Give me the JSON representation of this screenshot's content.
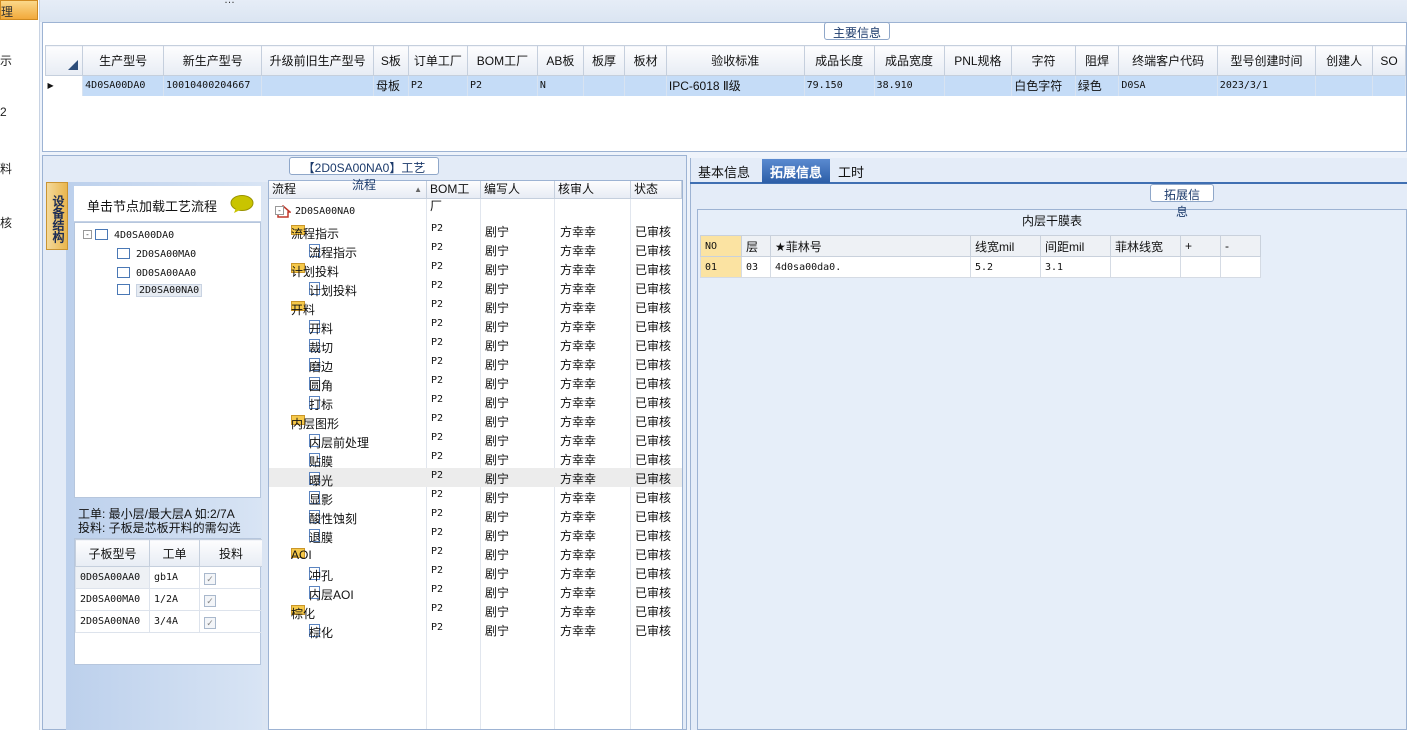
{
  "left_nav": {
    "active_label": "理",
    "items": [
      "示",
      "2",
      "料",
      "核"
    ]
  },
  "top": {
    "partial_title": "…"
  },
  "main_info": {
    "title": "主要信息",
    "columns": [
      "生产型号",
      "新生产型号",
      "升级前旧生产型号",
      "S板",
      "订单工厂",
      "BOM工厂",
      "AB板",
      "板厚",
      "板材",
      "验收标准",
      "成品长度",
      "成品宽度",
      "PNL规格",
      "字符",
      "阻焊",
      "终端客户代码",
      "型号创建时间",
      "创建人",
      "SO"
    ],
    "row": [
      "4D0SA00DA0",
      "10010400204667",
      "",
      "母板",
      "P2",
      "P2",
      "N",
      "",
      "",
      "IPC-6018 Ⅱ级",
      "79.150",
      "38.910",
      "",
      "白色字符",
      "绿色",
      "D0SA",
      "2023/3/1",
      "",
      ""
    ]
  },
  "structure_tab": "设备结构",
  "load_hint": "单击节点加载工艺流程",
  "structure_tree": {
    "root": "4D0SA00DA0",
    "children": [
      "2D0SA00MA0",
      "0D0SA00AA0",
      "2D0SA00NA0"
    ]
  },
  "hint": {
    "line1": "工单: 最小层/最大层A 如:2/7A",
    "line2": "投料: 子板是芯板开料的需勾选"
  },
  "sub_grid": {
    "headers": [
      "子板型号",
      "工单",
      "投料"
    ],
    "rows": [
      [
        "0D0SA00AA0",
        "gb1A"
      ],
      [
        "2D0SA00MA0",
        "1/2A"
      ],
      [
        "2D0SA00NA0",
        "3/4A"
      ]
    ]
  },
  "process": {
    "title": "【2D0SA00NA0】工艺流程",
    "headers": [
      "流程",
      "BOM工厂",
      "编写人",
      "核审人",
      "状态"
    ],
    "root": "2D0SA00NA0",
    "rows": [
      {
        "name": "流程指示",
        "lvl": 1,
        "bom": "P2",
        "writer": "剧宁",
        "reviewer": "方幸幸",
        "status": "已审核"
      },
      {
        "name": "流程指示",
        "lvl": 2,
        "bom": "P2",
        "writer": "剧宁",
        "reviewer": "方幸幸",
        "status": "已审核"
      },
      {
        "name": "计划投料",
        "lvl": 1,
        "bom": "P2",
        "writer": "剧宁",
        "reviewer": "方幸幸",
        "status": "已审核"
      },
      {
        "name": "计划投料",
        "lvl": 2,
        "bom": "P2",
        "writer": "剧宁",
        "reviewer": "方幸幸",
        "status": "已审核"
      },
      {
        "name": "开料",
        "lvl": 1,
        "bom": "P2",
        "writer": "剧宁",
        "reviewer": "方幸幸",
        "status": "已审核"
      },
      {
        "name": "开料",
        "lvl": 2,
        "bom": "P2",
        "writer": "剧宁",
        "reviewer": "方幸幸",
        "status": "已审核"
      },
      {
        "name": "裁切",
        "lvl": 2,
        "bom": "P2",
        "writer": "剧宁",
        "reviewer": "方幸幸",
        "status": "已审核"
      },
      {
        "name": "磨边",
        "lvl": 2,
        "bom": "P2",
        "writer": "剧宁",
        "reviewer": "方幸幸",
        "status": "已审核"
      },
      {
        "name": "圆角",
        "lvl": 2,
        "bom": "P2",
        "writer": "剧宁",
        "reviewer": "方幸幸",
        "status": "已审核"
      },
      {
        "name": "打标",
        "lvl": 2,
        "bom": "P2",
        "writer": "剧宁",
        "reviewer": "方幸幸",
        "status": "已审核"
      },
      {
        "name": "内层图形",
        "lvl": 1,
        "bom": "P2",
        "writer": "剧宁",
        "reviewer": "方幸幸",
        "status": "已审核"
      },
      {
        "name": "内层前处理",
        "lvl": 2,
        "bom": "P2",
        "writer": "剧宁",
        "reviewer": "方幸幸",
        "status": "已审核"
      },
      {
        "name": "贴膜",
        "lvl": 2,
        "bom": "P2",
        "writer": "剧宁",
        "reviewer": "方幸幸",
        "status": "已审核"
      },
      {
        "name": "曝光",
        "lvl": 2,
        "bom": "P2",
        "writer": "剧宁",
        "reviewer": "方幸幸",
        "status": "已审核"
      },
      {
        "name": "显影",
        "lvl": 2,
        "bom": "P2",
        "writer": "剧宁",
        "reviewer": "方幸幸",
        "status": "已审核"
      },
      {
        "name": "酸性蚀刻",
        "lvl": 2,
        "bom": "P2",
        "writer": "剧宁",
        "reviewer": "方幸幸",
        "status": "已审核"
      },
      {
        "name": "退膜",
        "lvl": 2,
        "bom": "P2",
        "writer": "剧宁",
        "reviewer": "方幸幸",
        "status": "已审核"
      },
      {
        "name": "AOI",
        "lvl": 1,
        "bom": "P2",
        "writer": "剧宁",
        "reviewer": "方幸幸",
        "status": "已审核"
      },
      {
        "name": "冲孔",
        "lvl": 2,
        "bom": "P2",
        "writer": "剧宁",
        "reviewer": "方幸幸",
        "status": "已审核"
      },
      {
        "name": "内层AOI",
        "lvl": 2,
        "bom": "P2",
        "writer": "剧宁",
        "reviewer": "方幸幸",
        "status": "已审核"
      },
      {
        "name": "棕化",
        "lvl": 1,
        "bom": "P2",
        "writer": "剧宁",
        "reviewer": "方幸幸",
        "status": "已审核"
      },
      {
        "name": "棕化",
        "lvl": 2,
        "bom": "P2",
        "writer": "剧宁",
        "reviewer": "方幸幸",
        "status": "已审核"
      }
    ]
  },
  "right_tabs": [
    "基本信息",
    "拓展信息",
    "工时"
  ],
  "ext": {
    "title": "拓展信息",
    "table_title": "内层干膜表",
    "headers": [
      "NO",
      "层",
      "★菲林号",
      "线宽mil",
      "间距mil",
      "菲林线宽",
      "+",
      "-"
    ],
    "row": [
      "01",
      "03",
      "4d0sa00da0.",
      "5.2",
      "3.1",
      "",
      "",
      ""
    ]
  }
}
